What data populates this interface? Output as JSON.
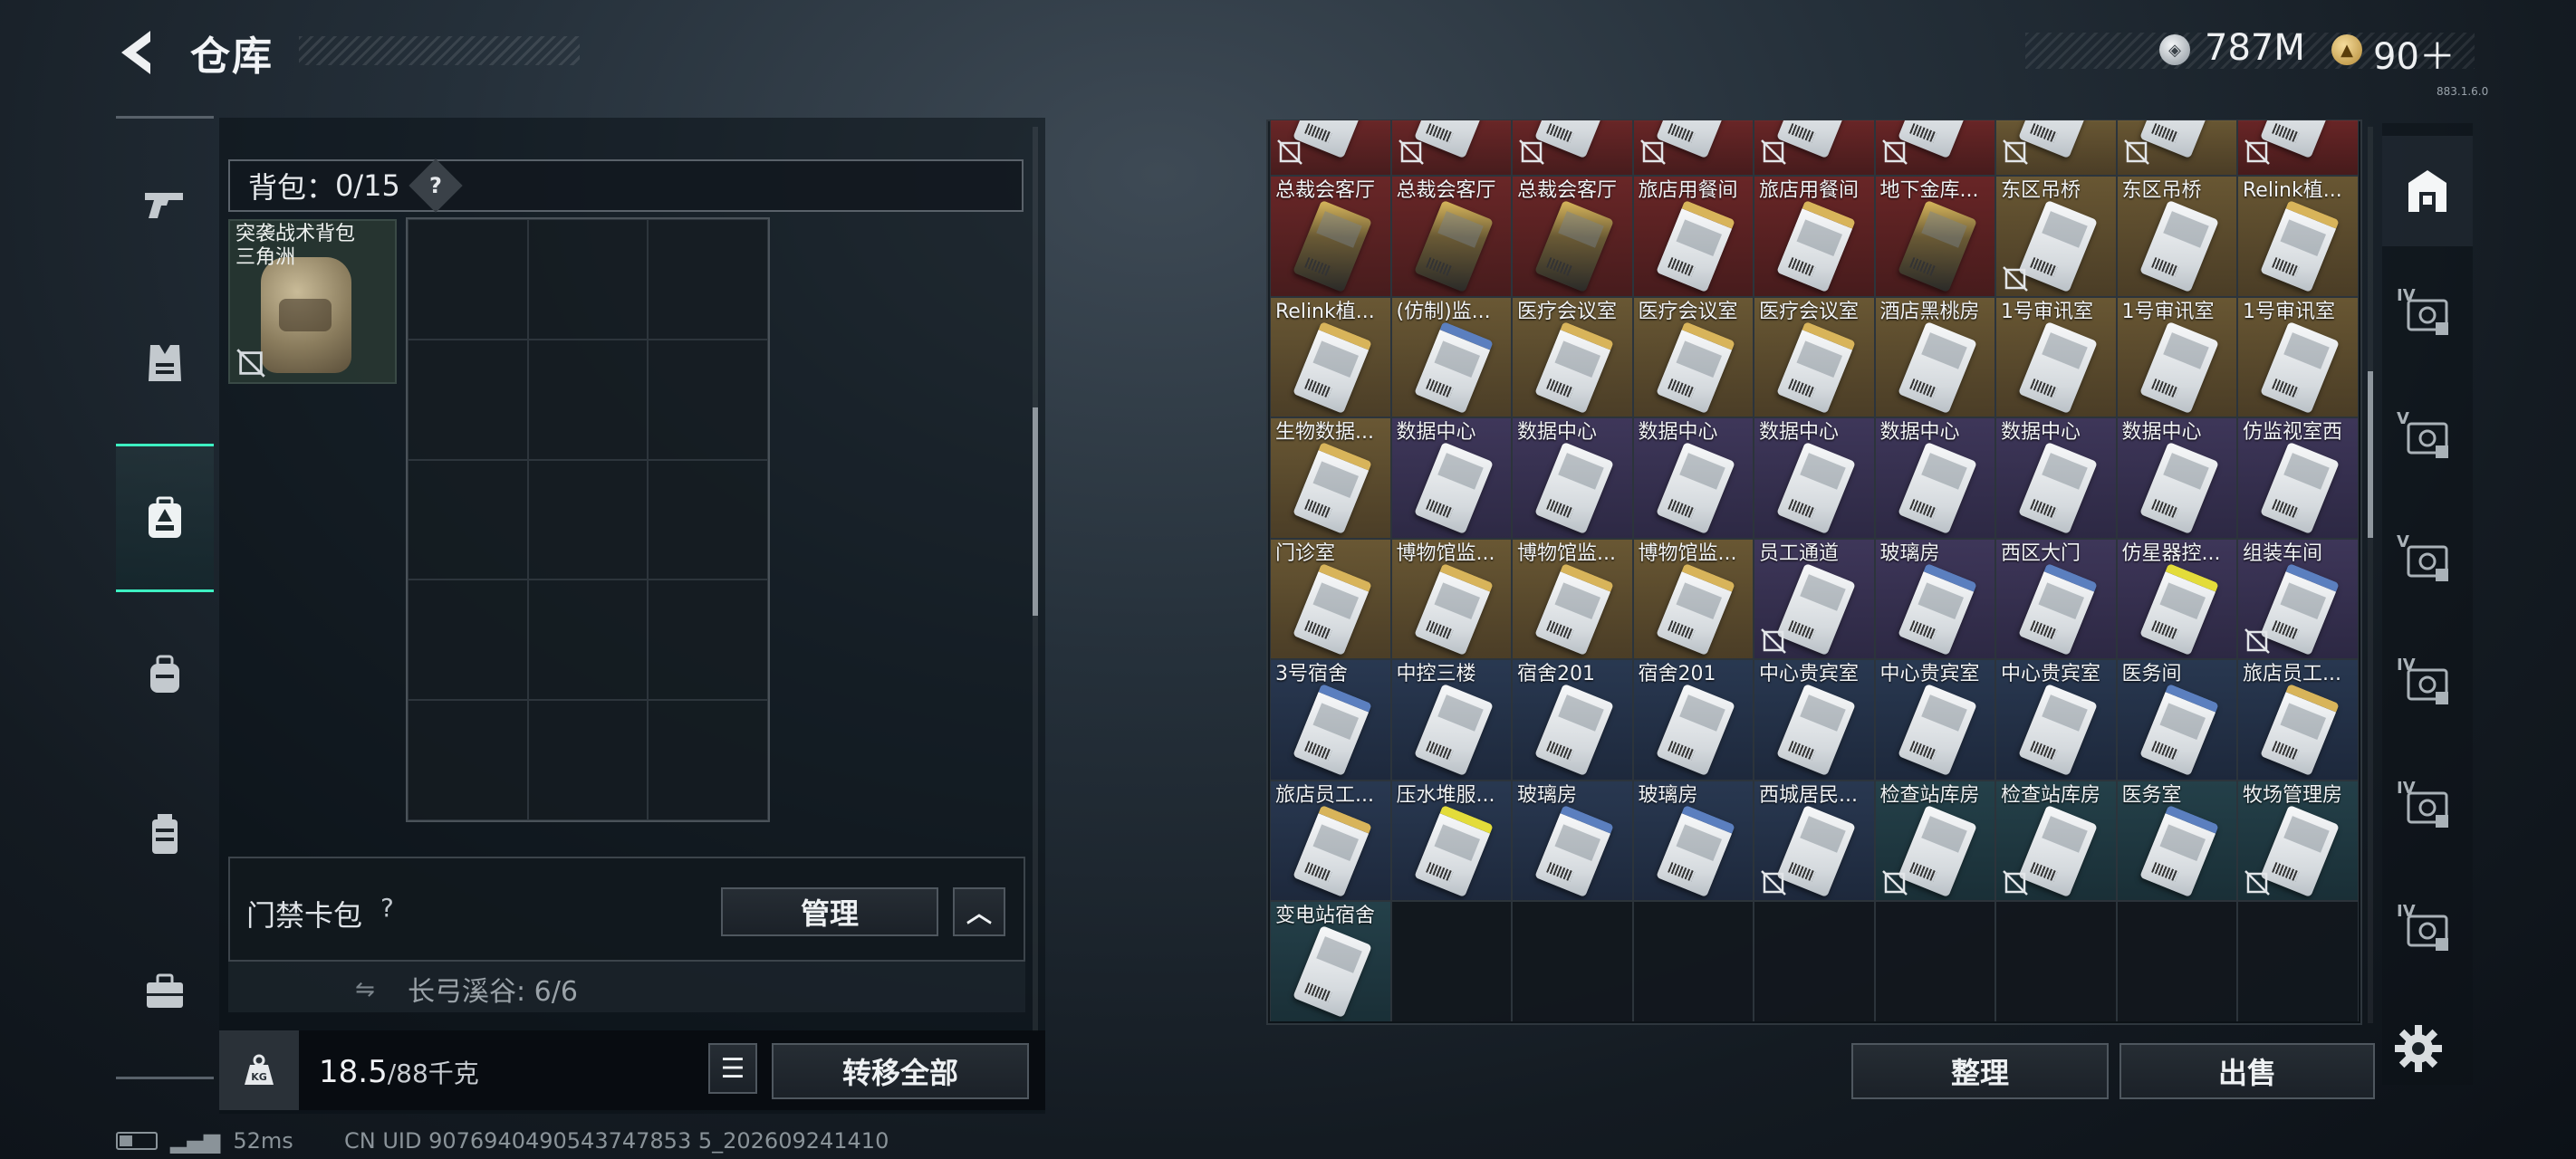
{
  "header": {
    "title": "仓库",
    "currency": [
      {
        "icon": "silver-coin-icon",
        "value": "787M"
      },
      {
        "icon": "gold-coin-icon",
        "value": "90＋"
      }
    ],
    "version_note": "883.1.6.0"
  },
  "left_nav": {
    "items": [
      {
        "icon": "gun-icon"
      },
      {
        "icon": "armor-vest-icon"
      },
      {
        "icon": "backpack-safe-icon",
        "active": true
      },
      {
        "icon": "backpack-icon"
      },
      {
        "icon": "chest-rig-icon"
      },
      {
        "icon": "toolbox-icon"
      }
    ],
    "accent_color": "#3df0c2"
  },
  "backpack": {
    "label": "背包：",
    "count": "0/15",
    "help": "?",
    "item_name": "突袭战术背包三角洲"
  },
  "keycard_pack": {
    "label": "门禁卡包",
    "help": "?",
    "manage_label": "管理",
    "collapse_glyph": "︿",
    "sub_text": "长弓溪谷: 6/6"
  },
  "weight": {
    "current": "18.5",
    "max": "/88千克",
    "kg_label": "KG"
  },
  "buttons": {
    "transfer_all": "转移全部",
    "sort": "整理",
    "sell": "出售",
    "list_glyph": "☰"
  },
  "storage": {
    "top_row": [
      {
        "rarity": "r-red"
      },
      {
        "rarity": "r-red"
      },
      {
        "rarity": "r-red"
      },
      {
        "rarity": "r-red"
      },
      {
        "rarity": "r-red"
      },
      {
        "rarity": "r-red"
      },
      {
        "rarity": "r-gold"
      },
      {
        "rarity": "r-gold"
      },
      {
        "rarity": "r-red"
      }
    ],
    "rows": [
      [
        {
          "name": "总裁会客厅",
          "rarity": "r-red",
          "card": "dark"
        },
        {
          "name": "总裁会客厅",
          "rarity": "r-red",
          "card": "dark"
        },
        {
          "name": "总裁会客厅",
          "rarity": "r-red",
          "card": "dark"
        },
        {
          "name": "旅店用餐间",
          "rarity": "r-red",
          "card": "stripe-gold"
        },
        {
          "name": "旅店用餐间",
          "rarity": "r-red",
          "card": "stripe-gold"
        },
        {
          "name": "地下金库...",
          "rarity": "r-red",
          "card": "dark"
        },
        {
          "name": "东区吊桥",
          "rarity": "r-gold",
          "card": "plain",
          "nolink": true
        },
        {
          "name": "东区吊桥",
          "rarity": "r-gold",
          "card": "plain"
        },
        {
          "name": "Relink植...",
          "rarity": "r-gold",
          "card": "stripe-gold"
        }
      ],
      [
        {
          "name": "Relink植...",
          "rarity": "r-gold",
          "card": "stripe-gold"
        },
        {
          "name": "(仿制)监...",
          "rarity": "r-gold",
          "card": "stripe-blue"
        },
        {
          "name": "医疗会议室",
          "rarity": "r-gold",
          "card": "stripe-gold"
        },
        {
          "name": "医疗会议室",
          "rarity": "r-gold",
          "card": "stripe-gold"
        },
        {
          "name": "医疗会议室",
          "rarity": "r-gold",
          "card": "stripe-gold"
        },
        {
          "name": "酒店黑桃房",
          "rarity": "r-gold",
          "card": "plain"
        },
        {
          "name": "1号审讯室",
          "rarity": "r-gold",
          "card": "plain"
        },
        {
          "name": "1号审讯室",
          "rarity": "r-gold",
          "card": "plain"
        },
        {
          "name": "1号审讯室",
          "rarity": "r-gold",
          "card": "plain"
        }
      ],
      [
        {
          "name": "生物数据...",
          "rarity": "r-gold",
          "card": "stripe-gold"
        },
        {
          "name": "数据中心",
          "rarity": "r-purple",
          "card": "plain"
        },
        {
          "name": "数据中心",
          "rarity": "r-purple",
          "card": "plain"
        },
        {
          "name": "数据中心",
          "rarity": "r-purple",
          "card": "plain"
        },
        {
          "name": "数据中心",
          "rarity": "r-purple",
          "card": "plain"
        },
        {
          "name": "数据中心",
          "rarity": "r-purple",
          "card": "plain"
        },
        {
          "name": "数据中心",
          "rarity": "r-purple",
          "card": "plain"
        },
        {
          "name": "数据中心",
          "rarity": "r-purple",
          "card": "plain"
        },
        {
          "name": "仿监视室西",
          "rarity": "r-purple",
          "card": "plain"
        }
      ],
      [
        {
          "name": "门诊室",
          "rarity": "r-gold",
          "card": "stripe-gold"
        },
        {
          "name": "博物馆监...",
          "rarity": "r-gold",
          "card": "stripe-gold"
        },
        {
          "name": "博物馆监...",
          "rarity": "r-gold",
          "card": "stripe-gold"
        },
        {
          "name": "博物馆监...",
          "rarity": "r-gold",
          "card": "stripe-gold"
        },
        {
          "name": "员工通道",
          "rarity": "r-purple",
          "card": "plain",
          "nolink": true
        },
        {
          "name": "玻璃房",
          "rarity": "r-purple",
          "card": "stripe-blue"
        },
        {
          "name": "西区大门",
          "rarity": "r-purple",
          "card": "stripe-blue"
        },
        {
          "name": "仿星器控...",
          "rarity": "r-purple",
          "card": "stripe-yellow"
        },
        {
          "name": "组装车间",
          "rarity": "r-purple",
          "card": "stripe-blue",
          "nolink": true
        }
      ],
      [
        {
          "name": "3号宿舍",
          "rarity": "r-blue",
          "card": "stripe-blue"
        },
        {
          "name": "中控三楼",
          "rarity": "r-blue",
          "card": "plain"
        },
        {
          "name": "宿舍201",
          "rarity": "r-blue",
          "card": "plain"
        },
        {
          "name": "宿舍201",
          "rarity": "r-blue",
          "card": "plain"
        },
        {
          "name": "中心贵宾室",
          "rarity": "r-blue",
          "card": "plain"
        },
        {
          "name": "中心贵宾室",
          "rarity": "r-blue",
          "card": "plain"
        },
        {
          "name": "中心贵宾室",
          "rarity": "r-blue",
          "card": "plain"
        },
        {
          "name": "医务间",
          "rarity": "r-blue",
          "card": "stripe-blue"
        },
        {
          "name": "旅店员工...",
          "rarity": "r-blue",
          "card": "stripe-gold"
        }
      ],
      [
        {
          "name": "旅店员工...",
          "rarity": "r-blue",
          "card": "stripe-gold"
        },
        {
          "name": "压水堆服...",
          "rarity": "r-blue",
          "card": "stripe-yellow"
        },
        {
          "name": "玻璃房",
          "rarity": "r-blue",
          "card": "stripe-blue"
        },
        {
          "name": "玻璃房",
          "rarity": "r-blue",
          "card": "stripe-blue"
        },
        {
          "name": "西城居民...",
          "rarity": "r-blue",
          "card": "plain",
          "nolink": true
        },
        {
          "name": "检查站库房",
          "rarity": "r-teal",
          "card": "plain",
          "nolink": true
        },
        {
          "name": "检查站库房",
          "rarity": "r-teal",
          "card": "plain",
          "nolink": true
        },
        {
          "name": "医务室",
          "rarity": "r-teal",
          "card": "stripe-blue"
        },
        {
          "name": "牧场管理房",
          "rarity": "r-teal",
          "card": "plain",
          "nolink": true
        }
      ],
      [
        {
          "name": "变电站宿舍",
          "rarity": "r-teal",
          "card": "plain"
        },
        null,
        null,
        null,
        null,
        null,
        null,
        null,
        null
      ]
    ]
  },
  "right_tabs": [
    {
      "icon": "vault-icon",
      "label": ""
    },
    {
      "icon": "tab-iv-icon",
      "label": "IV"
    },
    {
      "icon": "tab-v-icon",
      "label": "V"
    },
    {
      "icon": "tab-v-icon",
      "label": "V"
    },
    {
      "icon": "tab-iv-folder-icon",
      "label": "IV"
    },
    {
      "icon": "tab-iv-icon",
      "label": "IV"
    },
    {
      "icon": "tab-iv-icon",
      "label": "IV"
    }
  ],
  "status": {
    "ping": "52ms",
    "uid": "CN UID 9076940490543747853 5_202609241410"
  }
}
